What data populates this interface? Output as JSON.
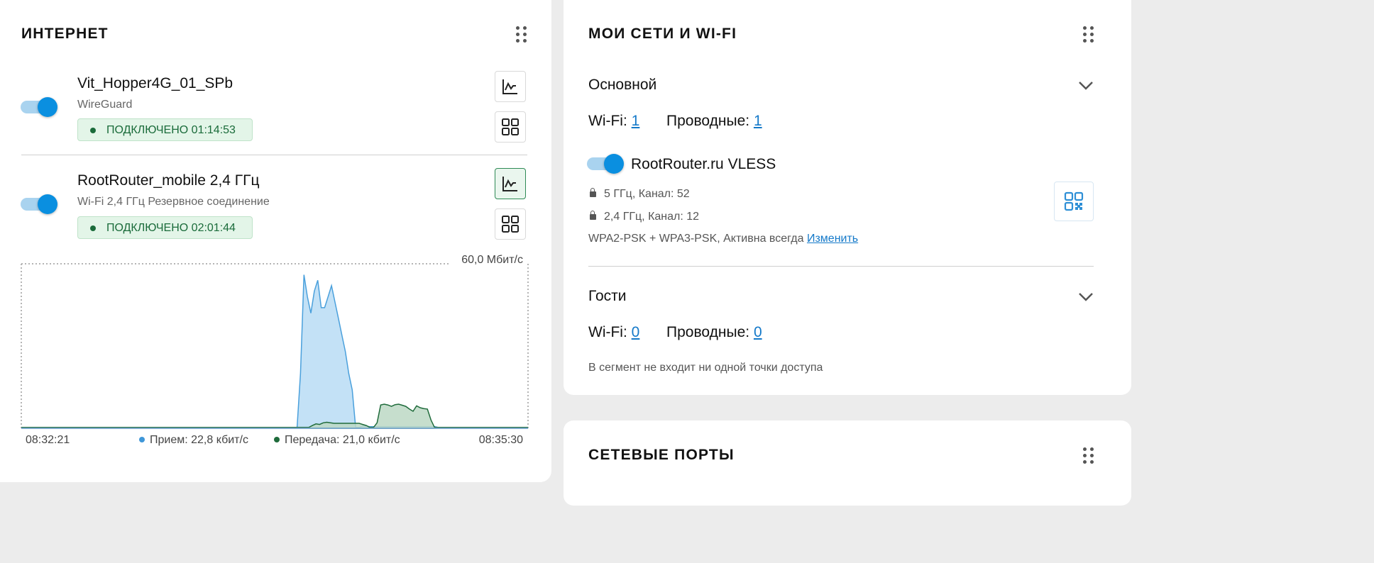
{
  "internet": {
    "title": "ИНТЕРНЕТ",
    "connections": [
      {
        "name": "Vit_Hopper4G_01_SPb",
        "type": "WireGuard",
        "status": "ПОДКЛЮЧЕНО 01:14:53",
        "enabled": true
      },
      {
        "name": "RootRouter_mobile 2,4 ГГц",
        "type": "Wi-Fi 2,4 ГГц Резервное соединение",
        "status": "ПОДКЛЮЧЕНО 02:01:44",
        "enabled": true
      }
    ],
    "icons": {
      "drag": "drag-handle-icon",
      "chart": "chart-line-icon",
      "apps": "grid-apps-icon"
    }
  },
  "chart_data": {
    "type": "area",
    "max_label": "60,0 Мбит/с",
    "ylim": [
      0,
      60
    ],
    "x_start_label": "08:32:21",
    "x_end_label": "08:35:30",
    "legend": {
      "receive": "Прием: 22,8 кбит/с",
      "transmit": "Передача: 21,0 кбит/с"
    },
    "colors": {
      "receive": "#4aa0dc",
      "receive_fill": "#b9dcf4",
      "transmit": "#1f6b3b",
      "transmit_fill": "#bcd8c4"
    },
    "series": [
      {
        "name": "Прием",
        "values": [
          0.3,
          0.3,
          0.3,
          0.3,
          0.3,
          0.3,
          0.3,
          0.3,
          0.3,
          0.3,
          0.3,
          0.3,
          0.3,
          0.3,
          0.3,
          0.3,
          0.3,
          0.3,
          0.3,
          0.3,
          0.3,
          0.3,
          0.3,
          0.3,
          0.3,
          0.3,
          0.3,
          0.3,
          0.3,
          0.3,
          0.3,
          0.3,
          0.3,
          0.3,
          0.3,
          0.3,
          0.3,
          0.3,
          0.3,
          0.3,
          0.3,
          0.3,
          0.3,
          0.3,
          0.3,
          0.3,
          0.3,
          0.3,
          0.3,
          0.3,
          0.3,
          0.3,
          0.3,
          0.3,
          0.3,
          0.3,
          0.3,
          0.3,
          0.3,
          0.3,
          0.3,
          0.3,
          0.3,
          0.3,
          0.3,
          0.3,
          0.3,
          0.3,
          0.3,
          0.3,
          0.3,
          0.3,
          0.3,
          0.3,
          0.3,
          0.3,
          0.3,
          0.3,
          0.3,
          0.3,
          0.3,
          20,
          56,
          48,
          42,
          50,
          54,
          44,
          44,
          48,
          52,
          46,
          40,
          34,
          28,
          20,
          14,
          0.3,
          0.3,
          0.8,
          0.8,
          0.6,
          0.6,
          0.6,
          0.6,
          0.6,
          0.6,
          0.6,
          0.6,
          0.6,
          0.6,
          0.6,
          0.6,
          0.6,
          0.6,
          0.6,
          0.6,
          0.6,
          0.6,
          0.6,
          0.6,
          0.3,
          0.3,
          0.3,
          0.3,
          0.3,
          0.3,
          0.3,
          0.3,
          0.3,
          0.3,
          0.3,
          0.3,
          0.3,
          0.3,
          0.3,
          0.3,
          0.3,
          0.3,
          0.3,
          0.3,
          0.3,
          0.3,
          0.3,
          0.3,
          0.3,
          0.3,
          0.3
        ]
      },
      {
        "name": "Передача",
        "values": [
          0.3,
          0.3,
          0.3,
          0.3,
          0.3,
          0.3,
          0.3,
          0.3,
          0.3,
          0.3,
          0.3,
          0.3,
          0.3,
          0.3,
          0.3,
          0.3,
          0.3,
          0.3,
          0.3,
          0.3,
          0.3,
          0.3,
          0.3,
          0.3,
          0.3,
          0.3,
          0.3,
          0.3,
          0.3,
          0.3,
          0.3,
          0.3,
          0.3,
          0.3,
          0.3,
          0.3,
          0.3,
          0.3,
          0.3,
          0.3,
          0.3,
          0.3,
          0.3,
          0.3,
          0.3,
          0.3,
          0.3,
          0.3,
          0.3,
          0.3,
          0.3,
          0.3,
          0.3,
          0.3,
          0.3,
          0.3,
          0.3,
          0.3,
          0.3,
          0.3,
          0.3,
          0.3,
          0.3,
          0.3,
          0.3,
          0.3,
          0.3,
          0.3,
          0.3,
          0.3,
          0.3,
          0.3,
          0.3,
          0.3,
          0.3,
          0.3,
          0.3,
          0.3,
          0.3,
          0.3,
          0.3,
          1.0,
          1.6,
          1.4,
          2.0,
          2.2,
          2.0,
          1.8,
          1.8,
          1.8,
          1.8,
          1.8,
          1.8,
          1.8,
          1.8,
          1.4,
          1.0,
          0.3,
          0.3,
          2.0,
          8.5,
          8.8,
          8.5,
          8.0,
          8.6,
          8.8,
          8.4,
          8.0,
          7.0,
          6.2,
          8.2,
          7.5,
          7.2,
          7.0,
          3.0,
          0.3,
          0.3,
          0.3,
          0.3,
          0.3,
          0.3,
          0.3,
          0.3,
          0.3,
          0.3,
          0.3,
          0.3,
          0.3,
          0.3,
          0.3,
          0.3,
          0.3,
          0.3,
          0.3,
          0.3,
          0.3,
          0.3,
          0.3,
          0.3,
          0.3,
          0.3,
          0.3
        ]
      }
    ]
  },
  "networks": {
    "title": "МОИ СЕТИ И WI-FI",
    "segments": [
      {
        "name": "Основной",
        "wifi_label": "Wi-Fi:",
        "wifi_count": "1",
        "wired_label": "Проводные:",
        "wired_count": "1",
        "ssid": "RootRouter.ru VLESS",
        "bands": [
          "5 ГГц, Канал: 52",
          "2,4 ГГц, Канал: 12"
        ],
        "security": "WPA2-PSK + WPA3-PSK, Активна всегда",
        "edit_label": "Изменить"
      },
      {
        "name": "Гости",
        "wifi_label": "Wi-Fi:",
        "wifi_count": "0",
        "wired_label": "Проводные:",
        "wired_count": "0",
        "empty_note": "В сегмент не входит ни одной точки доступа"
      }
    ]
  },
  "ports": {
    "title": "СЕТЕВЫЕ ПОРТЫ"
  }
}
